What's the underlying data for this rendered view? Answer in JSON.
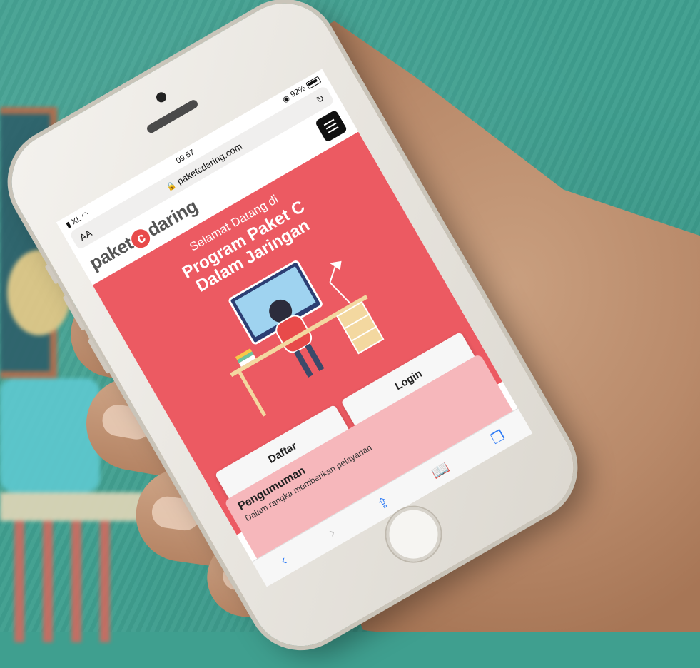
{
  "status": {
    "carrier": "XL",
    "time": "09.57",
    "battery": "92%"
  },
  "browser": {
    "aa_label": "AA",
    "url": "paketcdaring.com",
    "reload_icon": "reload-icon"
  },
  "site": {
    "logo_prefix": "paket",
    "logo_mid": "c",
    "logo_suffix": "daring",
    "menu_icon": "hamburger-icon"
  },
  "hero": {
    "welcome": "Selamat Datang di",
    "headline_line1": "Program Paket C",
    "headline_line2": "Dalam Jaringan",
    "daftar_label": "Daftar",
    "login_label": "Login"
  },
  "announcement": {
    "title": "Pengumuman",
    "text": "Dalam rangka memberikan pelayanan"
  },
  "toolbar": {
    "back_icon": "‹",
    "forward_icon": "›",
    "share_icon": "⇪",
    "bookmarks_icon": "📖",
    "tabs_icon": "❐"
  },
  "colors": {
    "hero": "#ec5a62",
    "background": "#3f9f8f",
    "link": "#2f7cf6"
  }
}
